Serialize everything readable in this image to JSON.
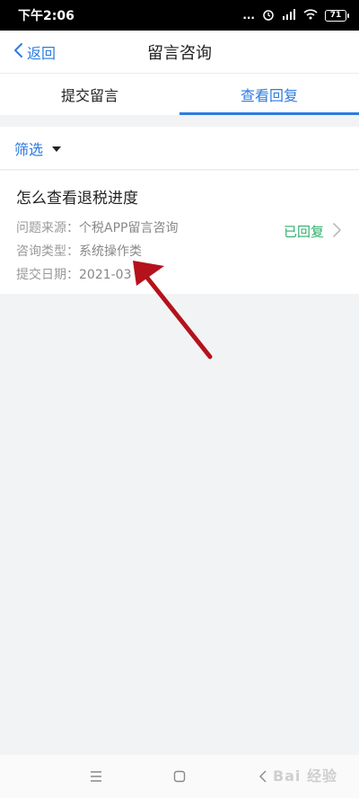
{
  "status_bar": {
    "time": "下午2:06",
    "dots": "...",
    "battery": "71"
  },
  "nav": {
    "back_label": "返回",
    "title": "留言咨询"
  },
  "tabs": [
    {
      "label": "提交留言",
      "active": false
    },
    {
      "label": "查看回复",
      "active": true
    }
  ],
  "filter": {
    "label": "筛选"
  },
  "message": {
    "title": "怎么查看退税进度",
    "source_label": "问题来源：",
    "source_value": "个税APP留言咨询",
    "type_label": "咨询类型：",
    "type_value": "系统操作类",
    "date_label": "提交日期：",
    "date_value": "2021-03",
    "status": "已回复"
  },
  "colors": {
    "accent": "#2e7ce0",
    "status_green": "#2eaf6a",
    "annotation_arrow": "#b5121b"
  },
  "watermark": "Bai 经验"
}
